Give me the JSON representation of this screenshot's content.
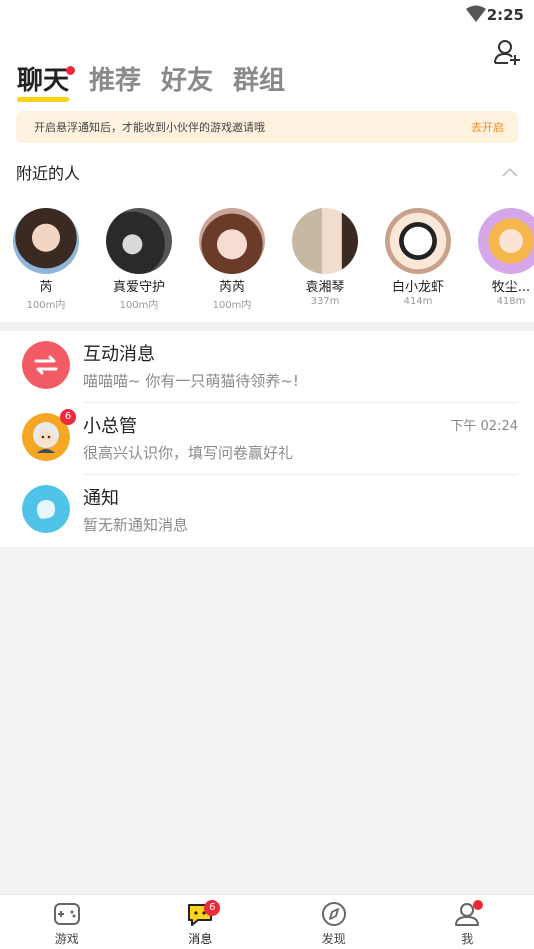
{
  "status_bar": {
    "time": "2:25"
  },
  "tabs": [
    {
      "label": "聊天",
      "active": true,
      "has_dot": true
    },
    {
      "label": "推荐",
      "active": false
    },
    {
      "label": "好友",
      "active": false
    },
    {
      "label": "群组",
      "active": false
    }
  ],
  "notice": {
    "text": "开启悬浮通知后，才能收到小伙伴的游戏邀请哦",
    "action_label": "去开启"
  },
  "nearby": {
    "title": "附近的人",
    "people": [
      {
        "name": "芮",
        "distance": "100m内"
      },
      {
        "name": "真爱守护",
        "distance": "100m内"
      },
      {
        "name": "芮芮",
        "distance": "100m内"
      },
      {
        "name": "袁湘琴",
        "distance": "337m"
      },
      {
        "name": "白小龙虾",
        "distance": "414m"
      },
      {
        "name": "牧尘...",
        "distance": "418m"
      }
    ]
  },
  "messages": [
    {
      "title": "互动消息",
      "subtitle": "喵喵喵~ 你有一只萌猫待领养~!",
      "time": "",
      "badge": "",
      "icon": "interaction-icon",
      "color": "#f25a64"
    },
    {
      "title": "小总管",
      "subtitle": "很高兴认识你，填写问卷赢好礼",
      "time": "下午 02:24",
      "badge": "6",
      "icon": "manager-avatar",
      "color": "#f5a623"
    },
    {
      "title": "通知",
      "subtitle": "暂无新通知消息",
      "time": "",
      "badge": "",
      "icon": "notification-icon",
      "color": "#4fc3e8"
    }
  ],
  "bottom_nav": [
    {
      "label": "游戏",
      "icon": "gamepad-icon",
      "badge": "",
      "dot": false
    },
    {
      "label": "消息",
      "icon": "message-icon",
      "badge": "6",
      "dot": false,
      "active": true
    },
    {
      "label": "发现",
      "icon": "compass-icon",
      "badge": "",
      "dot": false
    },
    {
      "label": "我",
      "icon": "profile-icon",
      "badge": "",
      "dot": true
    }
  ],
  "colors": {
    "accent": "#ffd31a",
    "badge": "#f0283c",
    "notice_bg": "#fff3e0",
    "notice_link": "#f28b1f"
  }
}
